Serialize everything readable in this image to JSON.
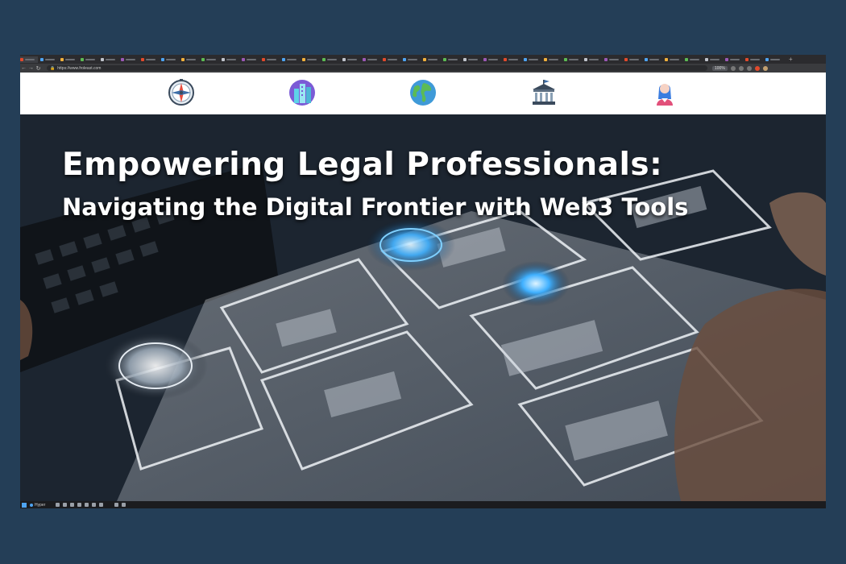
{
  "browser": {
    "url": "https://www.froleast.com",
    "zoom": "100%",
    "tab_count": 38
  },
  "header": {
    "nav_icons": [
      {
        "name": "compass-icon"
      },
      {
        "name": "city-icon"
      },
      {
        "name": "globe-icon"
      },
      {
        "name": "bank-icon"
      },
      {
        "name": "person-icon"
      }
    ]
  },
  "hero": {
    "title": "Empowering Legal Professionals:",
    "subtitle": "Navigating the Digital Frontier with Web3 Tools"
  },
  "taskbar": {
    "search_label": "Hyper"
  },
  "colors": {
    "page_background": "#243e57",
    "header_background": "#ffffff",
    "accent_blue": "#4ea4f2"
  }
}
